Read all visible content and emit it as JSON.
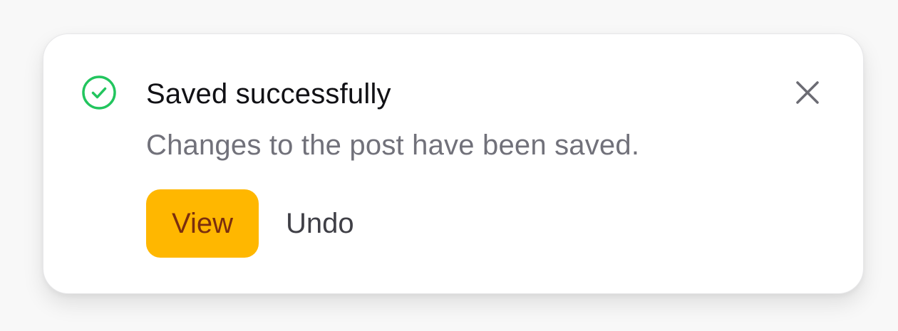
{
  "toast": {
    "title": "Saved successfully",
    "message": "Changes to the post have been saved.",
    "status_icon": "check-circle-icon",
    "close_icon": "close-icon",
    "actions": {
      "primary_label": "View",
      "secondary_label": "Undo"
    },
    "colors": {
      "success": "#22c55e",
      "primary_button_bg": "#ffb700",
      "primary_button_text": "#7a2e0e",
      "title": "#111115",
      "message": "#71717a",
      "close_icon": "#6b6b73"
    }
  }
}
